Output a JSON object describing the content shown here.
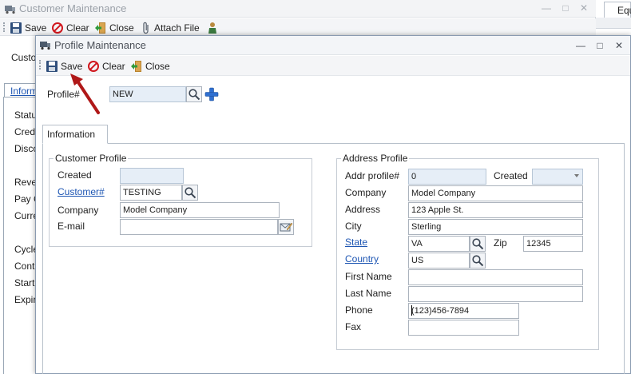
{
  "background_window": {
    "title": "Customer Maintenance",
    "toolbar": {
      "save_label": "Save",
      "clear_label": "Clear",
      "close_label": "Close",
      "attach_label": "Attach File"
    },
    "labels": [
      "Custo",
      "Status",
      "Credi",
      "Disco",
      "Reve",
      "Pay C",
      "Curre",
      "Cycle",
      "Contr",
      "Start",
      "Expir"
    ],
    "tab_label": "Inform",
    "right_tab": "Equ"
  },
  "dialog": {
    "title": "Profile Maintenance",
    "toolbar": {
      "save_label": "Save",
      "clear_label": "Clear",
      "close_label": "Close"
    },
    "profile": {
      "label": "Profile#",
      "value": "NEW"
    },
    "tab_label": "Information",
    "customer_profile": {
      "title": "Customer Profile",
      "created_label": "Created",
      "created_value": "",
      "customer_label": "Customer#",
      "customer_value": "TESTING",
      "company_label": "Company",
      "company_value": "Model Company",
      "email_label": "E-mail",
      "email_value": ""
    },
    "address_profile": {
      "title": "Address Profile",
      "addr_label": "Addr profile#",
      "addr_value": "0",
      "created_label": "Created",
      "created_value": "",
      "company_label": "Company",
      "company_value": "Model Company",
      "address_label": "Address",
      "address_value": "123 Apple St.",
      "city_label": "City",
      "city_value": "Sterling",
      "state_label": "State",
      "state_value": "VA",
      "zip_label": "Zip",
      "zip_value": "12345",
      "country_label": "Country",
      "country_value": "US",
      "first_name_label": "First Name",
      "first_name_value": "",
      "last_name_label": "Last Name",
      "last_name_value": "",
      "phone_label": "Phone",
      "phone_value": "(123)456-7894",
      "fax_label": "Fax",
      "fax_value": ""
    }
  },
  "colors": {
    "link": "#1e56b3",
    "readonly_field": "#e6eef7",
    "arrow": "#b01818"
  }
}
